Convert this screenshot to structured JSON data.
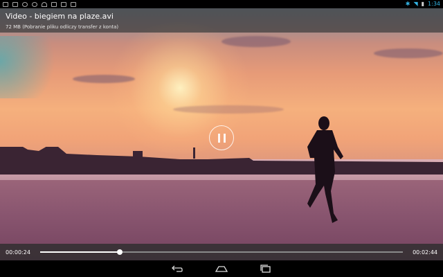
{
  "status_bar": {
    "left_icons": [
      "photo-icon",
      "image-icon",
      "upload-icon",
      "clock-icon",
      "headphones-icon",
      "video-icon",
      "video-icon",
      "video-icon"
    ],
    "right_icons": [
      "bluetooth-icon",
      "wifi-icon",
      "battery-icon"
    ],
    "time": "1:34"
  },
  "video": {
    "title": "Video - biegiem na plaze.avi",
    "subtitle": "72 MB (Pobranie pliku odliczy transfer z konta)"
  },
  "playback": {
    "state_icon": "pause-icon",
    "current_time": "00:00:24",
    "total_time": "00:02:44",
    "progress_fraction": 0.22
  },
  "navigation": {
    "items": [
      "back-icon",
      "home-icon",
      "recent-apps-icon"
    ]
  },
  "colors": {
    "status_accent": "#33b5e5"
  }
}
